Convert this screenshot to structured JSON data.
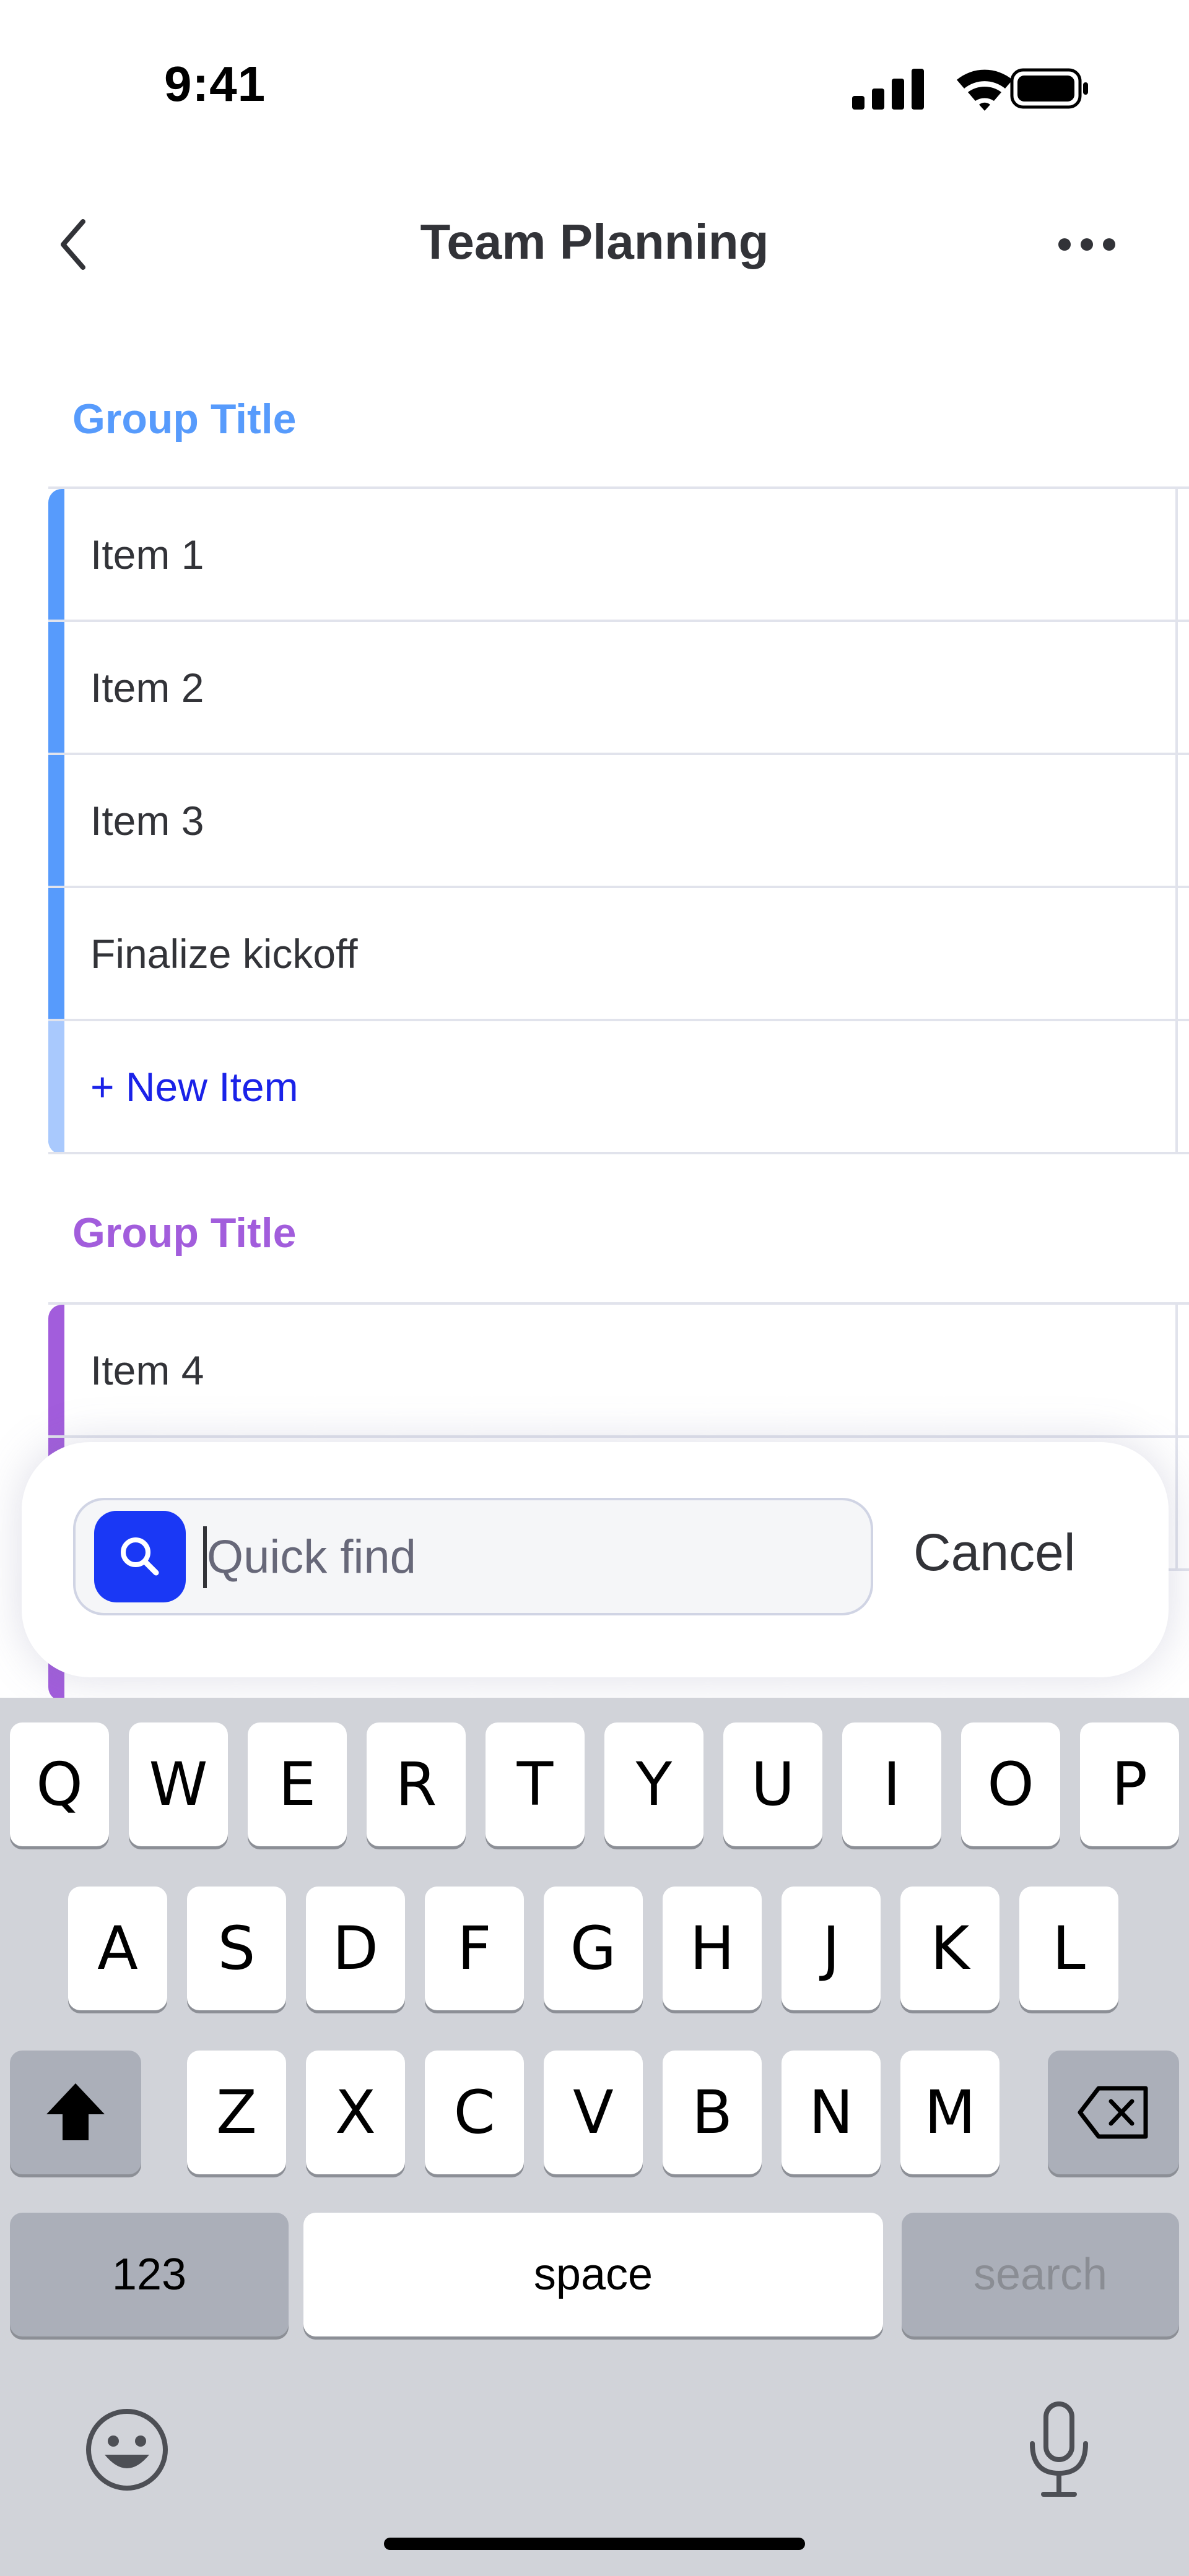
{
  "status_bar": {
    "time": "9:41"
  },
  "header": {
    "title": "Team Planning"
  },
  "groups": [
    {
      "title": "Group Title",
      "color": "#579bfc",
      "items": [
        "Item 1",
        "Item 2",
        "Item 3",
        "Finalize kickoff"
      ],
      "new_item_label": "+ New Item"
    },
    {
      "title": "Group Title",
      "color": "#a25ddc",
      "items": [
        "Item 4"
      ]
    }
  ],
  "search": {
    "placeholder": "Quick find",
    "value": "",
    "cancel_label": "Cancel"
  },
  "keyboard": {
    "row1": [
      "Q",
      "W",
      "E",
      "R",
      "T",
      "Y",
      "U",
      "I",
      "O",
      "P"
    ],
    "row2": [
      "A",
      "S",
      "D",
      "F",
      "G",
      "H",
      "J",
      "K",
      "L"
    ],
    "row3": [
      "Z",
      "X",
      "C",
      "V",
      "B",
      "N",
      "M"
    ],
    "numbers_label": "123",
    "space_label": "space",
    "search_label": "search"
  }
}
